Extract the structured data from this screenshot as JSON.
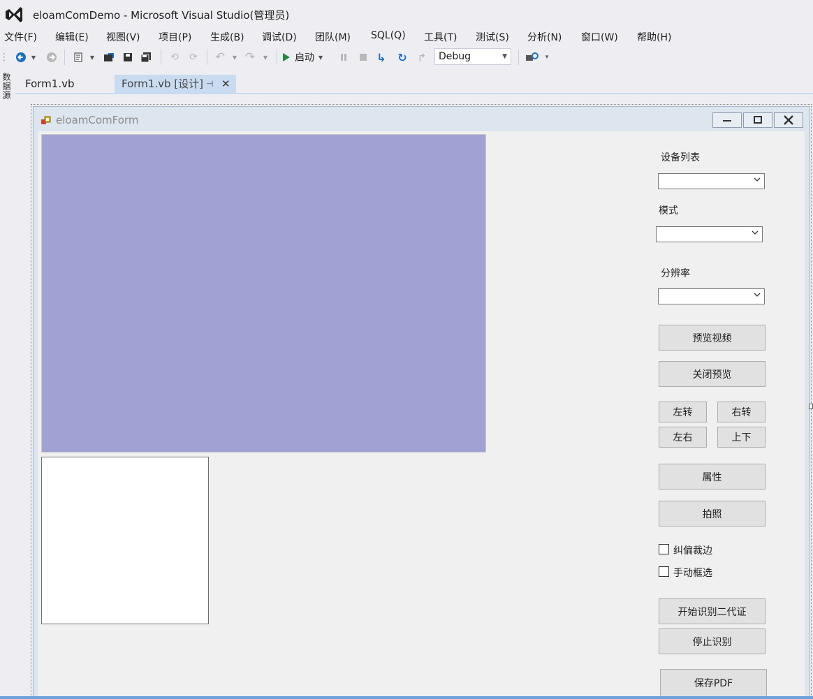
{
  "window": {
    "title": "eloamComDemo - Microsoft Visual Studio(管理员)"
  },
  "menu": {
    "items": [
      {
        "label": "文件(F)"
      },
      {
        "label": "编辑(E)"
      },
      {
        "label": "视图(V)"
      },
      {
        "label": "项目(P)"
      },
      {
        "label": "生成(B)"
      },
      {
        "label": "调试(D)"
      },
      {
        "label": "团队(M)"
      },
      {
        "label": "SQL(Q)"
      },
      {
        "label": "工具(T)"
      },
      {
        "label": "测试(S)"
      },
      {
        "label": "分析(N)"
      },
      {
        "label": "窗口(W)"
      },
      {
        "label": "帮助(H)"
      }
    ]
  },
  "toolbar": {
    "start_label": "启动",
    "config_value": "Debug",
    "icons": [
      "back-icon",
      "forward-icon",
      "new-project-icon",
      "open-file-icon",
      "save-icon",
      "save-all-icon",
      "undo-icon",
      "redo-icon",
      "start-icon",
      "pause-icon",
      "stop-icon",
      "step-into-icon",
      "step-over-icon",
      "step-out-icon",
      "find-icon"
    ],
    "colors": {
      "start": "#1e8a3a",
      "back": "#1e6fc0"
    }
  },
  "side_panel": {
    "label": "数据源"
  },
  "tabs": [
    {
      "label": "Form1.vb",
      "active": false
    },
    {
      "label": "Form1.vb [设计]",
      "active": true
    }
  ],
  "form": {
    "caption": "eloamComForm",
    "preview_color": "#a1a1d4",
    "labels": {
      "device_list": "设备列表",
      "mode": "模式",
      "resolution": "分辨率"
    },
    "combos": {
      "device_list": "",
      "mode": "",
      "resolution": ""
    },
    "buttons": {
      "preview": "预览视频",
      "close_preview": "关闭预览",
      "rotate_left": "左转",
      "rotate_right": "右转",
      "flip_lr": "左右",
      "flip_ud": "上下",
      "properties": "属性",
      "capture": "拍照",
      "start_id": "开始识别二代证",
      "stop_id": "停止识别",
      "save_pdf": "保存PDF"
    },
    "checkboxes": {
      "deskew": {
        "label": "纠偏裁边",
        "checked": false
      },
      "manual_select": {
        "label": "手动框选",
        "checked": false
      }
    }
  }
}
